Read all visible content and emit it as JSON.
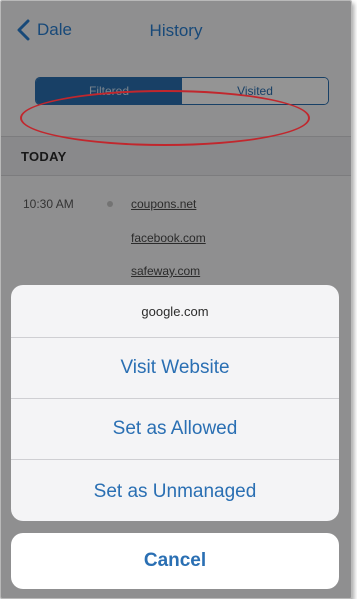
{
  "nav": {
    "back_label": "Dale",
    "title": "History"
  },
  "segments": [
    "Filtered",
    "Visited"
  ],
  "section": {
    "title": "TODAY"
  },
  "history": {
    "time": "10:30 AM",
    "links": [
      "coupons.net",
      "facebook.com",
      "safeway.com"
    ]
  },
  "sheet": {
    "title": "google.com",
    "actions": [
      "Visit Website",
      "Set as Allowed",
      "Set as Unmanaged"
    ],
    "cancel_label": "Cancel"
  },
  "colors": {
    "accent": "#2a6fb3",
    "highlight_circle": "#c1272d"
  }
}
